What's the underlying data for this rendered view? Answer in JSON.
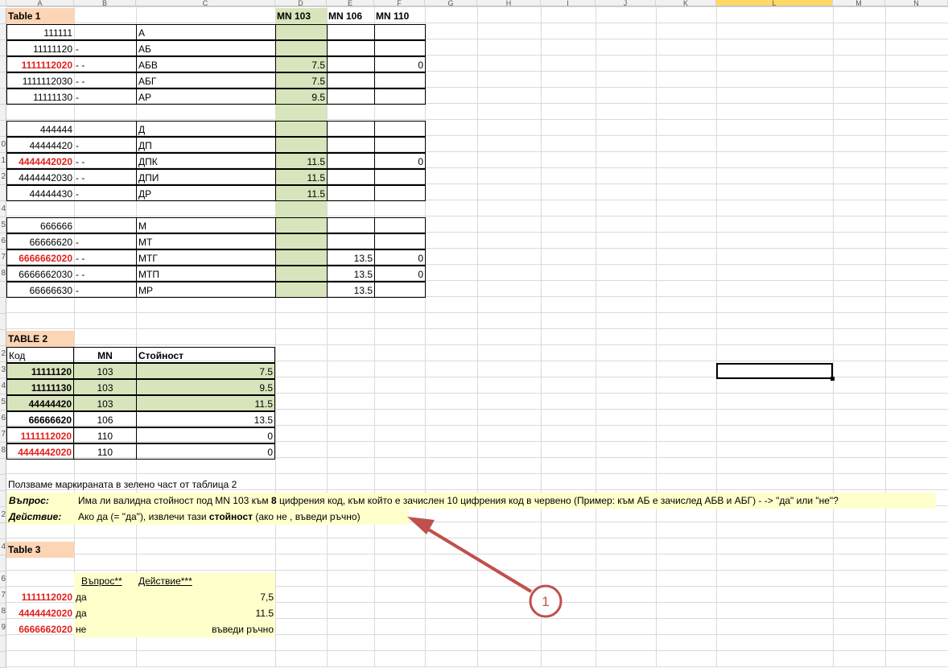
{
  "columns": [
    "A",
    "B",
    "C",
    "D",
    "E",
    "F",
    "G",
    "H",
    "I",
    "J",
    "K",
    "L",
    "M",
    "N"
  ],
  "selected_column": "L",
  "table1": {
    "title": "Table 1",
    "headers": [
      "MN 103",
      "MN 106",
      "MN 110"
    ],
    "rows": [
      {
        "code": "111111",
        "dash": "",
        "name": "А",
        "d": "",
        "e": "",
        "f": "",
        "red": false
      },
      {
        "code": "11111120",
        "dash": "-",
        "name": "АБ",
        "d": "",
        "e": "",
        "f": "",
        "red": false
      },
      {
        "code": "1111112020",
        "dash": "- -",
        "name": "АБВ",
        "d": "7.5",
        "e": "",
        "f": "0",
        "red": true
      },
      {
        "code": "1111112030",
        "dash": "- -",
        "name": "АБГ",
        "d": "7.5",
        "e": "",
        "f": "",
        "red": false
      },
      {
        "code": "11111130",
        "dash": "-",
        "name": "АР",
        "d": "9.5",
        "e": "",
        "f": "",
        "red": false
      },
      {
        "code": "",
        "dash": "",
        "name": "",
        "d": "",
        "e": "",
        "f": "",
        "red": false
      },
      {
        "code": "444444",
        "dash": "",
        "name": "Д",
        "d": "",
        "e": "",
        "f": "",
        "red": false
      },
      {
        "code": "44444420",
        "dash": "-",
        "name": "ДП",
        "d": "",
        "e": "",
        "f": "",
        "red": false
      },
      {
        "code": "4444442020",
        "dash": "- -",
        "name": "ДПК",
        "d": "11.5",
        "e": "",
        "f": "0",
        "red": true
      },
      {
        "code": "4444442030",
        "dash": "- -",
        "name": "ДПИ",
        "d": "11.5",
        "e": "",
        "f": "",
        "red": false
      },
      {
        "code": "44444430",
        "dash": "-",
        "name": "ДР",
        "d": "11.5",
        "e": "",
        "f": "",
        "red": false
      },
      {
        "code": "",
        "dash": "",
        "name": "",
        "d": "",
        "e": "",
        "f": "",
        "red": false
      },
      {
        "code": "666666",
        "dash": "",
        "name": "М",
        "d": "",
        "e": "",
        "f": "",
        "red": false
      },
      {
        "code": "66666620",
        "dash": "-",
        "name": "МТ",
        "d": "",
        "e": "",
        "f": "",
        "red": false
      },
      {
        "code": "6666662020",
        "dash": "- -",
        "name": "МТГ",
        "d": "",
        "e": "13.5",
        "f": "0",
        "red": true
      },
      {
        "code": "6666662030",
        "dash": "- -",
        "name": "МТП",
        "d": "",
        "e": "13.5",
        "f": "0",
        "red": false
      },
      {
        "code": "66666630",
        "dash": "-",
        "name": "МР",
        "d": "",
        "e": "13.5",
        "f": "",
        "red": false
      }
    ]
  },
  "table2": {
    "title": "TABLE 2",
    "headers": [
      "Код",
      "MN",
      "Стойност"
    ],
    "rows": [
      {
        "code": "11111120",
        "mn": "103",
        "value": "7.5",
        "green": true,
        "red": false
      },
      {
        "code": "11111130",
        "mn": "103",
        "value": "9.5",
        "green": true,
        "red": false
      },
      {
        "code": "44444420",
        "mn": "103",
        "value": "11.5",
        "green": true,
        "red": false
      },
      {
        "code": "66666620",
        "mn": "106",
        "value": "13.5",
        "green": false,
        "red": false
      },
      {
        "code": "1111112020",
        "mn": "110",
        "value": "0",
        "green": false,
        "red": true
      },
      {
        "code": "4444442020",
        "mn": "110",
        "value": "0",
        "green": false,
        "red": true
      }
    ]
  },
  "notes": {
    "line1": "Ползваме маркираната в зелено част от таблица 2",
    "question_label": "Въпрос:",
    "question_prefix": "Има ли валидна стойност под MN 103 към ",
    "question_bold": "8",
    "question_suffix": " цифрения код, към който е зачислен 10 цифрения код в червено (Пример: към АБ е зачислед АБВ и АБГ)  - -> \"да\" или \"не\"?",
    "action_label": "Действие:",
    "action_prefix": "Ако да (= \"да\"), извлечи тази ",
    "action_bold": "стойност",
    "action_suffix": " (ако не , въведи ръчно)"
  },
  "table3": {
    "title": "Table 3",
    "headers": [
      "Въпрос**",
      "Действие***"
    ],
    "rows": [
      {
        "code": "1111112020",
        "answer": "да",
        "action": "7,5"
      },
      {
        "code": "4444442020",
        "answer": "да",
        "action": "11.5"
      },
      {
        "code": "6666662020",
        "answer": "не",
        "action": "въведи ръчно"
      }
    ]
  },
  "callout": {
    "number": "1",
    "color": "#c0504d"
  },
  "row_numbers": [
    "",
    "",
    "",
    "",
    "",
    "",
    "",
    "",
    "0",
    "1",
    "2",
    "",
    "4",
    "5",
    "6",
    "7",
    "8",
    "",
    "",
    "",
    "",
    "2",
    "3",
    "4",
    "5",
    "6",
    "7",
    "8",
    "",
    "",
    "",
    "2",
    "",
    "4",
    "",
    "6",
    "7",
    "8",
    "9"
  ]
}
